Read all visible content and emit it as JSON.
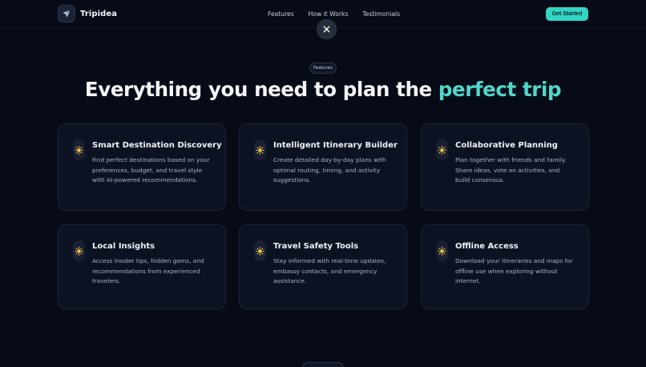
{
  "header": {
    "brand": "Tripidea",
    "nav": [
      "Features",
      "How it Works",
      "Testimonials"
    ],
    "cta_label": "Get Started"
  },
  "section": {
    "badge": "Features",
    "headline_main": "Everything you need to plan the ",
    "headline_accent": "perfect trip"
  },
  "features": [
    {
      "title": "Smart Destination Discovery",
      "description": "Find perfect destinations based on your preferences, budget, and travel style with AI-powered recommendations."
    },
    {
      "title": "Intelligent Itinerary Builder",
      "description": "Create detailed day-by-day plans with optimal routing, timing, and activity suggestions."
    },
    {
      "title": "Collaborative Planning",
      "description": "Plan together with friends and family. Share ideas, vote on activities, and build consensus."
    },
    {
      "title": "Local Insights",
      "description": "Access insider tips, hidden gems, and recommendations from experienced travelers."
    },
    {
      "title": "Travel Safety Tools",
      "description": "Stay informed with real-time updates, embassy contacts, and emergency assistance."
    },
    {
      "title": "Offline Access",
      "description": "Download your itineraries and maps for offline use when exploring without internet."
    }
  ],
  "icons": {
    "logo": "plane-icon",
    "close": "close-icon",
    "feature": "sun-icon"
  },
  "colors": {
    "background": "#070b18",
    "accent": "#4fd8c9",
    "cta": "#33d6c5",
    "card": "#0d1222",
    "sun": "#f2c94c"
  }
}
